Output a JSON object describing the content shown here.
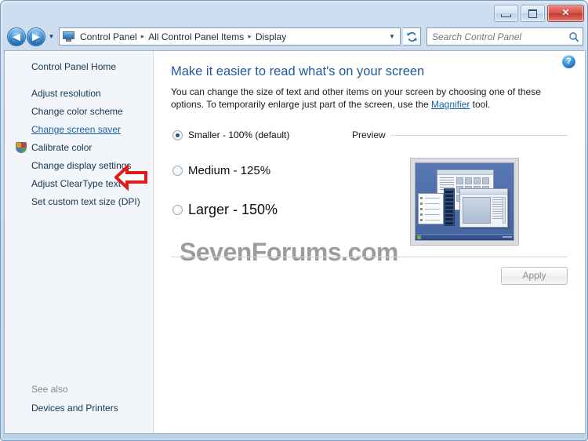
{
  "window": {
    "controls": {
      "minimize_label": "Minimize",
      "maximize_label": "Maximize",
      "close_label": "✕"
    }
  },
  "navbar": {
    "back_glyph": "◀",
    "forward_glyph": "▶",
    "recent_glyph": "▼",
    "address_icon": "display-icon",
    "breadcrumbs": [
      "Control Panel",
      "All Control Panel Items",
      "Display"
    ],
    "separator": "▸",
    "dropdown_glyph": "▼",
    "refresh_icon": "refresh-icon",
    "search": {
      "placeholder": "Search Control Panel",
      "value": "",
      "icon": "search-icon"
    }
  },
  "sidebar": {
    "home_label": "Control Panel Home",
    "items": [
      {
        "label": "Adjust resolution",
        "icon": null,
        "highlighted": false
      },
      {
        "label": "Change color scheme",
        "icon": null,
        "highlighted": false
      },
      {
        "label": "Change screen saver",
        "icon": null,
        "highlighted": true
      },
      {
        "label": "Calibrate color",
        "icon": "uac-shield-icon",
        "highlighted": false
      },
      {
        "label": "Change display settings",
        "icon": null,
        "highlighted": false
      },
      {
        "label": "Adjust ClearType text",
        "icon": null,
        "highlighted": false
      },
      {
        "label": "Set custom text size (DPI)",
        "icon": null,
        "highlighted": false
      }
    ],
    "see_also": {
      "title": "See also",
      "links": [
        "Devices and Printers"
      ]
    }
  },
  "content": {
    "help_icon": "help-icon",
    "help_glyph": "?",
    "title": "Make it easier to read what's on your screen",
    "description_before": "You can change the size of text and other items on your screen by choosing one of these options. To temporarily enlarge just part of the screen, use the ",
    "description_link": "Magnifier",
    "description_after": " tool.",
    "options": [
      {
        "label": "Smaller - 100% (default)",
        "selected": true
      },
      {
        "label": "Medium - 125%",
        "selected": false
      },
      {
        "label": "Larger - 150%",
        "selected": false
      }
    ],
    "preview": {
      "label": "Preview",
      "thumbnail_alt": "desktop-preview-thumbnail"
    },
    "watermark": "SevenForums.com",
    "apply_label": "Apply"
  },
  "annotation": {
    "arrow": "red-left-arrow",
    "arrow_color": "#e01b1b",
    "points_to": "Change screen saver"
  },
  "colors": {
    "frame": "#b9d0e9",
    "accent_blue": "#1f5a9c",
    "link_blue": "#1763a8",
    "sidebar_bg": "#f2f6fb",
    "close_red": "#c23a31",
    "annotation_red": "#e01b1b",
    "watermark_gray": "#8b8b8b"
  }
}
